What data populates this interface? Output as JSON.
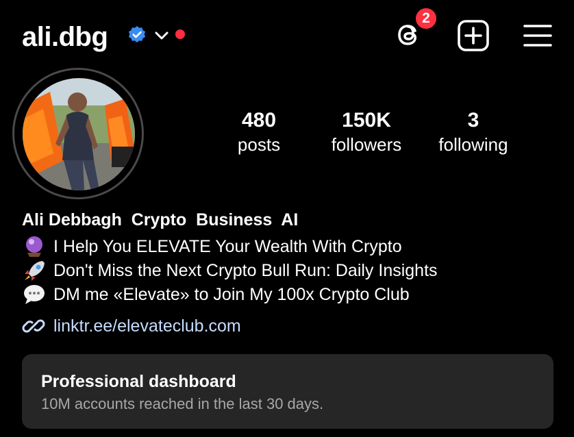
{
  "header": {
    "username": "ali.dbg",
    "threads_badge_count": "2",
    "icons": [
      "verified-badge-icon",
      "chevron-down-icon",
      "notification-dot",
      "threads-icon",
      "create-plus-icon",
      "menu-icon"
    ]
  },
  "stats": [
    {
      "value": "480",
      "label": "posts"
    },
    {
      "value": "150K",
      "label": "followers"
    },
    {
      "value": "3",
      "label": "following"
    }
  ],
  "bio": {
    "name": "Ali Debbagh  Crypto  Business  AI",
    "lines": [
      {
        "emoji": "crystal-ball-icon",
        "text": "I Help You ELEVATE Your Wealth With Crypto"
      },
      {
        "emoji": "rocket-icon",
        "text": "Don't Miss the Next Crypto Bull Run: Daily Insights"
      },
      {
        "emoji": "speech-bubble-icon",
        "text": "DM me «Elevate» to Join My 100x Crypto Club"
      }
    ],
    "link": "linktr.ee/elevateclub.com"
  },
  "dashboard": {
    "title": "Professional dashboard",
    "subtitle": "10M accounts reached in the last 30 days."
  },
  "colors": {
    "background": "#000000",
    "verified": "#3b8cf0",
    "badge_red": "#ff3040",
    "link": "#c6dcff",
    "card": "#262626",
    "muted": "#a8a8a8"
  }
}
